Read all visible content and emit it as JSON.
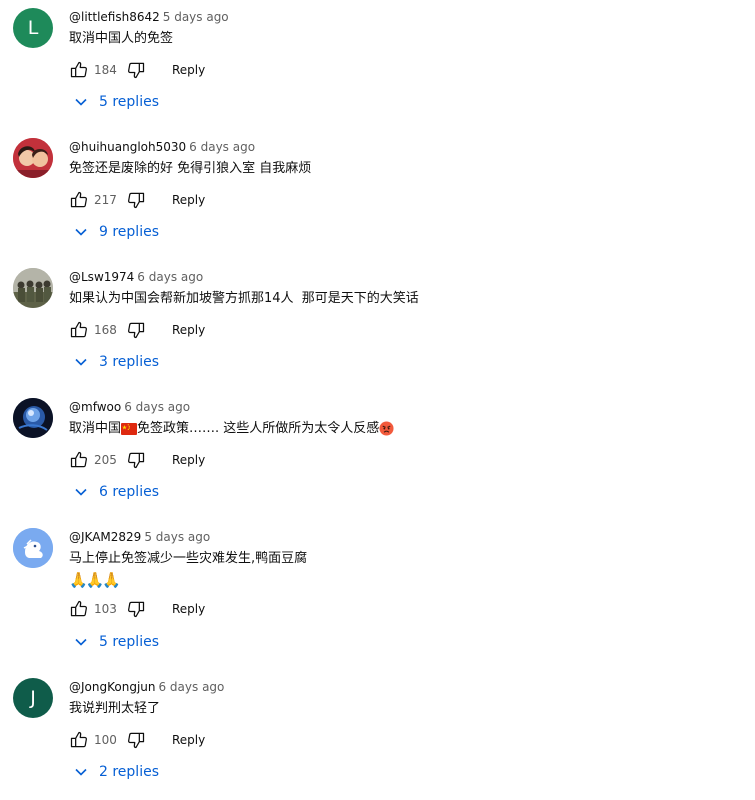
{
  "reply_label": "Reply",
  "colors": {
    "link": "#065fd4",
    "meta": "#606060"
  },
  "comments": [
    {
      "author": "@littlefish8642",
      "time": "5 days ago",
      "text": "取消中国人的免签",
      "likes": "184",
      "replies": "5 replies",
      "avatar_letter": "L",
      "avatar_color": "#1e8a5a"
    },
    {
      "author": "@huihuangloh5030",
      "time": "6 days ago",
      "text": "免签还是废除的好 免得引狼入室 自我麻烦",
      "likes": "217",
      "replies": "9 replies",
      "avatar_letter": "",
      "avatar_color": "#c2313b"
    },
    {
      "author": "@Lsw1974",
      "time": "6 days ago",
      "text": "如果认为中国会帮新加坡警方抓那14人  那可是天下的大笑话",
      "likes": "168",
      "replies": "3 replies",
      "avatar_letter": "",
      "avatar_color": "#6b6f5a"
    },
    {
      "author": "@mfwoo",
      "time": "6 days ago",
      "text_a": "取消中国",
      "text_b": "免签政策……. 这些人所做所为太令人反感",
      "likes": "205",
      "replies": "6 replies",
      "avatar_letter": "",
      "avatar_color": "#1a2a4a"
    },
    {
      "author": "@JKAM2829",
      "time": "5 days ago",
      "text": "马上停止免签减少一些灾难发生,鸭面豆腐",
      "text2": "🙏🙏🙏",
      "likes": "103",
      "replies": "5 replies",
      "avatar_letter": "",
      "avatar_color": "#6aa0e6"
    },
    {
      "author": "@JongKongjun",
      "time": "6 days ago",
      "text": "我说判刑太轻了",
      "likes": "100",
      "replies": "2 replies",
      "avatar_letter": "J",
      "avatar_color": "#0f5c4a"
    }
  ]
}
